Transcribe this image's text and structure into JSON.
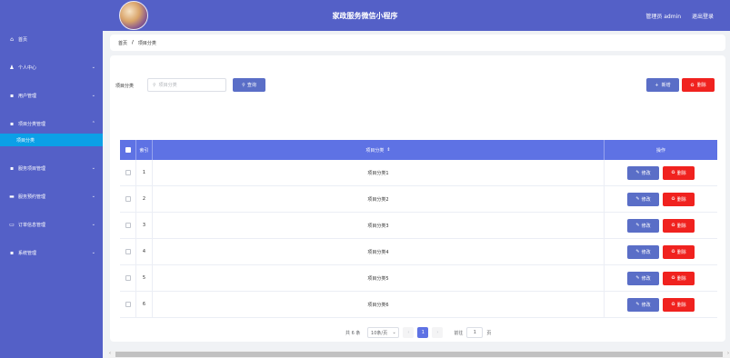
{
  "header": {
    "title": "家政服务微信小程序",
    "user_label": "管理员 admin",
    "logout_label": "退出登录"
  },
  "sidebar": {
    "items": [
      {
        "icon": "home-icon",
        "glyph": "⌂",
        "label": "首页",
        "chevron": false
      },
      {
        "icon": "user-icon",
        "glyph": "♟",
        "label": "个人中心",
        "chevron": true
      },
      {
        "icon": "grid-icon",
        "glyph": "▪",
        "label": "用户管理",
        "chevron": true
      },
      {
        "icon": "grid-icon",
        "glyph": "▪",
        "label": "项目分类管理",
        "chevron": true
      },
      {
        "icon": "grid-icon",
        "glyph": "▪",
        "label": "服务项目管理",
        "chevron": true
      },
      {
        "icon": "card-icon",
        "glyph": "▬",
        "label": "服务预约管理",
        "chevron": true
      },
      {
        "icon": "inbox-icon",
        "glyph": "▭",
        "label": "订单信息管理",
        "chevron": true
      },
      {
        "icon": "grid-icon",
        "glyph": "▪",
        "label": "系统管理",
        "chevron": true
      }
    ],
    "active_sub": "项目分类"
  },
  "breadcrumb": {
    "home": "首页",
    "separator": "/",
    "current": "项目分类"
  },
  "search": {
    "label": "项目分类",
    "placeholder": "项目分类",
    "query_label": "查询",
    "add_label": "新增",
    "delete_label": "删除"
  },
  "table": {
    "columns": {
      "index": "索引",
      "name": "项目分类",
      "ops": "操作"
    },
    "rows": [
      {
        "index": "1",
        "name": "项目分类1"
      },
      {
        "index": "2",
        "name": "项目分类2"
      },
      {
        "index": "3",
        "name": "项目分类3"
      },
      {
        "index": "4",
        "name": "项目分类4"
      },
      {
        "index": "5",
        "name": "项目分类5"
      },
      {
        "index": "6",
        "name": "项目分类6"
      }
    ],
    "edit_label": "修改",
    "delete_label": "删除"
  },
  "pagination": {
    "total": "共 6 条",
    "page_size": "10条/页",
    "current_page": "1",
    "goto_label": "前往",
    "goto_value": "1",
    "page_word": "页"
  },
  "colors": {
    "sidebar": "#5460c7",
    "active": "#0ba0e7",
    "primary": "#5e72e4",
    "danger": "#f0221f"
  }
}
